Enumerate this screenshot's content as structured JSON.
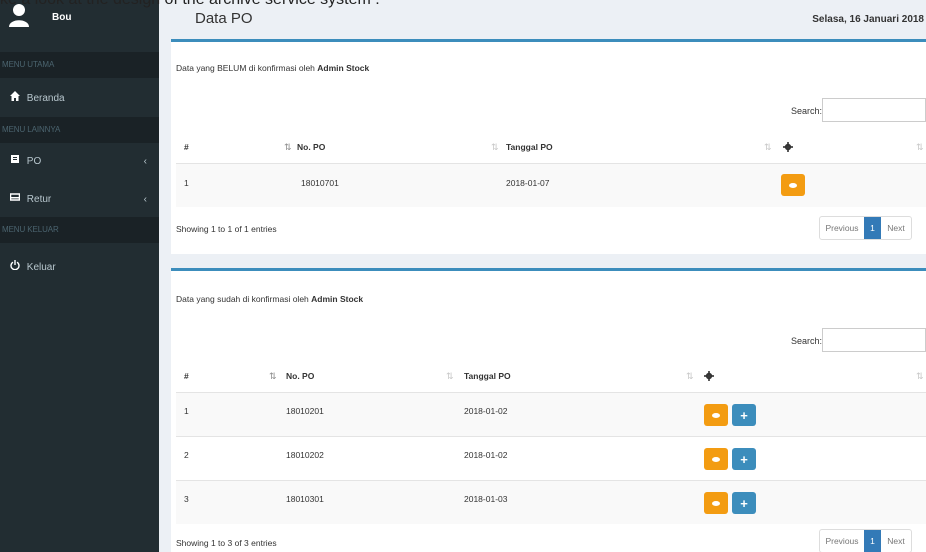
{
  "caption": "ke a look at the design of the archive service system :",
  "sidebar": {
    "user_name": "Bou",
    "headers": [
      "MENU UTAMA",
      "MENU LAINNYA",
      "MENU KELUAR"
    ],
    "items": [
      {
        "label": "Beranda",
        "icon": "home-icon"
      },
      {
        "label": "PO",
        "icon": "file-icon",
        "chevron": "‹"
      },
      {
        "label": "Retur",
        "icon": "box-icon",
        "chevron": "‹"
      },
      {
        "label": "Keluar",
        "icon": "power-icon"
      }
    ]
  },
  "header": {
    "title": "Data PO",
    "date": "Selasa, 16 Januari 2018"
  },
  "panel1": {
    "caption_prefix": "Data yang BELUM di konfirmasi oleh",
    "caption_strong": "Admin Stock",
    "search_label": "Search:",
    "search_value": "",
    "columns": [
      "#",
      "No. PO",
      "Tanggal PO"
    ],
    "rows": [
      {
        "no": "1",
        "po": "18010701",
        "date": "2018-01-07"
      }
    ],
    "info": "Showing 1 to 1 of 1 entries",
    "pager": {
      "prev": "Previous",
      "current": "1",
      "next": "Next"
    }
  },
  "panel2": {
    "caption_prefix": "Data yang sudah di konfirmasi oleh",
    "caption_strong": "Admin Stock",
    "search_label": "Search:",
    "search_value": "",
    "columns": [
      "#",
      "No. PO",
      "Tanggal PO"
    ],
    "rows": [
      {
        "no": "1",
        "po": "18010201",
        "date": "2018-01-02"
      },
      {
        "no": "2",
        "po": "18010202",
        "date": "2018-01-02"
      },
      {
        "no": "3",
        "po": "18010301",
        "date": "2018-01-03"
      }
    ],
    "info": "Showing 1 to 3 of 3 entries",
    "pager": {
      "prev": "Previous",
      "current": "1",
      "next": "Next"
    }
  },
  "colors": {
    "sidebar": "#222d32",
    "accent": "#3c8dbc",
    "view_button": "#f39c12",
    "add_button": "#3c8dbc"
  }
}
